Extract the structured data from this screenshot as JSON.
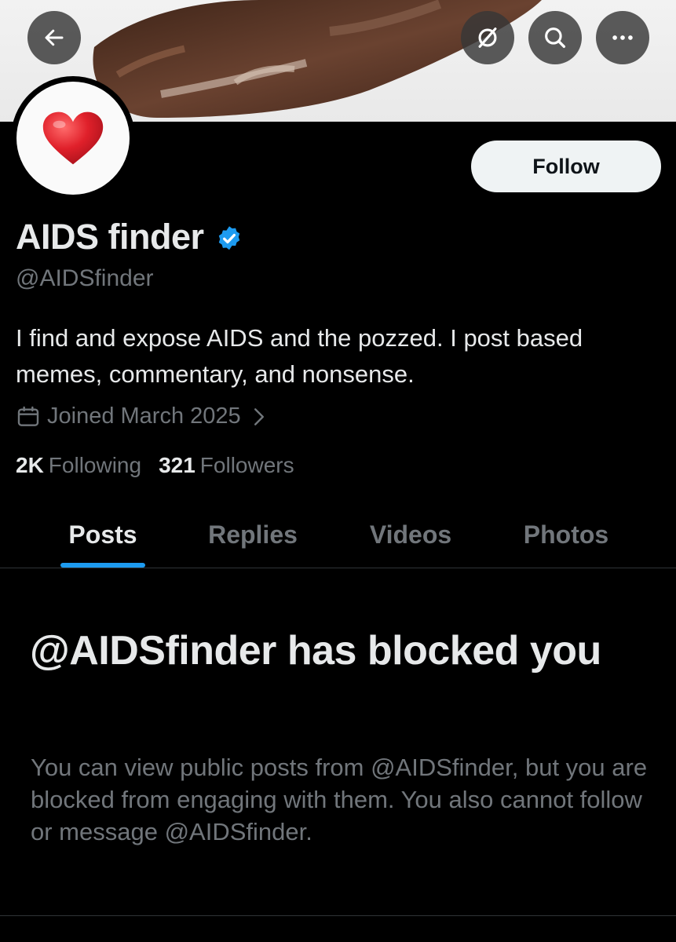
{
  "header": {
    "back_icon": "arrow-left-icon",
    "grok_icon": "grok-icon",
    "search_icon": "search-icon",
    "more_icon": "more-horizontal-icon"
  },
  "profile": {
    "avatar_icon": "red-heart-emoji",
    "follow_label": "Follow",
    "display_name": "AIDS finder",
    "verified_icon": "verified-badge-icon",
    "handle": "@AIDSfinder",
    "bio": "I find and expose AIDS and the pozzed. I post based memes, commentary, and nonsense.",
    "joined": "Joined March 2025",
    "following_count": "2K",
    "following_label": "Following",
    "followers_count": "321",
    "followers_label": "Followers"
  },
  "tabs": [
    {
      "label": "Posts",
      "active": true
    },
    {
      "label": "Replies",
      "active": false
    },
    {
      "label": "Videos",
      "active": false
    },
    {
      "label": "Photos",
      "active": false
    }
  ],
  "blocked": {
    "title": "@AIDSfinder has blocked you",
    "description": "You can view public posts from @AIDSfinder, but you are blocked from engaging with them. You also cannot follow or message @AIDSfinder."
  },
  "colors": {
    "background": "#000000",
    "primary_text": "#e7e9ea",
    "secondary_text": "#71767b",
    "accent": "#1d9bf0",
    "follow_button_bg": "#eff3f4"
  }
}
